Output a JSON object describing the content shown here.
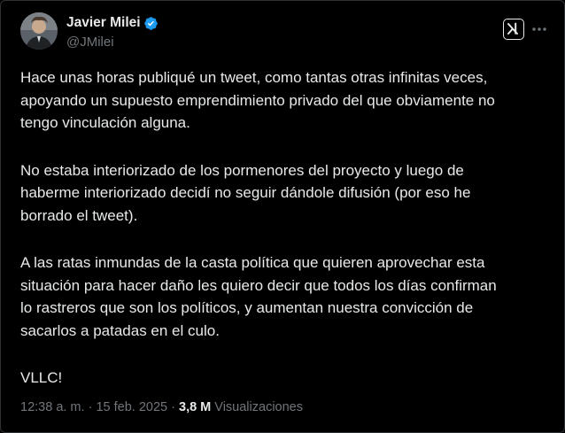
{
  "author": {
    "display_name": "Javier Milei",
    "handle": "@JMilei",
    "verified": true
  },
  "icons": {
    "verified": "verified-badge-icon",
    "grok": "grok-icon",
    "more": "more-options-icon"
  },
  "colors": {
    "background": "#000000",
    "text_primary": "#e7e9ea",
    "text_secondary": "#71767b",
    "verified_badge": "#1d9bf0"
  },
  "tweet": {
    "paragraphs": [
      {
        "lines": [
          "Hace unas horas publiqué un tweet, como tantas otras infinitas veces,",
          "apoyando un supuesto emprendimiento privado del que obviamente no",
          "tengo vinculación alguna."
        ]
      },
      {
        "lines": [
          "No estaba interiorizado de los pormenores del proyecto y luego de",
          "haberme interiorizado decidí no seguir dándole difusión (por eso he",
          "borrado el tweet)."
        ]
      },
      {
        "lines": [
          "A las ratas inmundas de la casta política que quieren aprovechar esta",
          "situación para hacer daño les quiero decir que todos los días confirman",
          "lo rastreros que son los políticos, y aumentan nuestra convicción de",
          "sacarlos a patadas en el culo."
        ]
      },
      {
        "lines": [
          "VLLC!"
        ]
      }
    ]
  },
  "meta": {
    "time": "12:38 a. m.",
    "separator": "·",
    "date": "15 feb. 2025",
    "views_count": "3,8 M",
    "views_label": "Visualizaciones"
  }
}
